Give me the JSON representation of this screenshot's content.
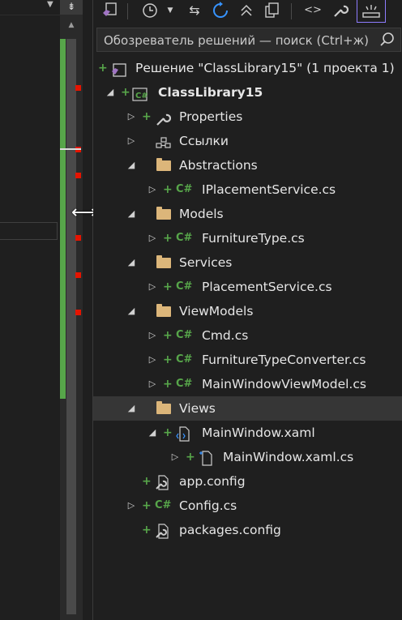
{
  "search": {
    "placeholder": "Обозреватель решений — поиск (Ctrl+ж)"
  },
  "solution": {
    "label": "Решение \"ClassLibrary15\"  (1 проекта 1)"
  },
  "project": {
    "label": "ClassLibrary15"
  },
  "tree": {
    "properties": "Properties",
    "references": "Ссылки",
    "abstractions": "Abstractions",
    "iplacement": "IPlacementService.cs",
    "models": "Models",
    "furnituretype": "FurnitureType.cs",
    "services": "Services",
    "placement": "PlacementService.cs",
    "viewmodels": "ViewModels",
    "cmd": "Cmd.cs",
    "converter": "FurnitureTypeConverter.cs",
    "mainvm": "MainWindowViewModel.cs",
    "views": "Views",
    "mainxaml": "MainWindow.xaml",
    "mainxamlcs": "MainWindow.xaml.cs",
    "appconfig": "app.config",
    "config": "Config.cs",
    "packages": "packages.config"
  },
  "colors": {
    "accent_green": "#57a64a",
    "folder": "#dcb67a",
    "error_mark": "#e51400",
    "selection": "#363636"
  }
}
